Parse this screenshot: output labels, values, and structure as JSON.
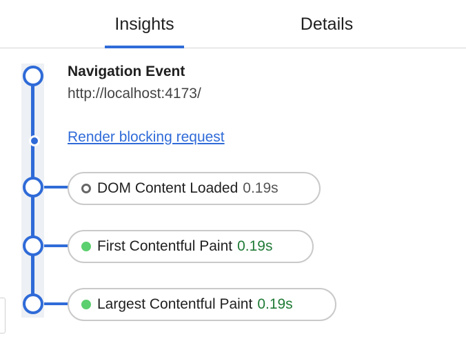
{
  "tabs": [
    {
      "label": "Insights",
      "active": true
    },
    {
      "label": "Details",
      "active": false
    }
  ],
  "navigation": {
    "title": "Navigation Event",
    "url": "http://localhost:4173/"
  },
  "render_blocking_link": "Render blocking request",
  "events": [
    {
      "label": "DOM Content Loaded",
      "value": "0.19s",
      "marker": "hollow-circle-icon",
      "value_color": "#555555"
    },
    {
      "label": "First Contentful Paint",
      "value": "0.19s",
      "marker": "green-dot-icon",
      "value_color": "#1f7a35"
    },
    {
      "label": "Largest Contentful Paint",
      "value": "0.19s",
      "marker": "green-dot-icon",
      "value_color": "#1f7a35"
    }
  ],
  "colors": {
    "accent": "#2f6bd8",
    "track": "#edf0f4",
    "marker_green": "#5ccf6e"
  }
}
